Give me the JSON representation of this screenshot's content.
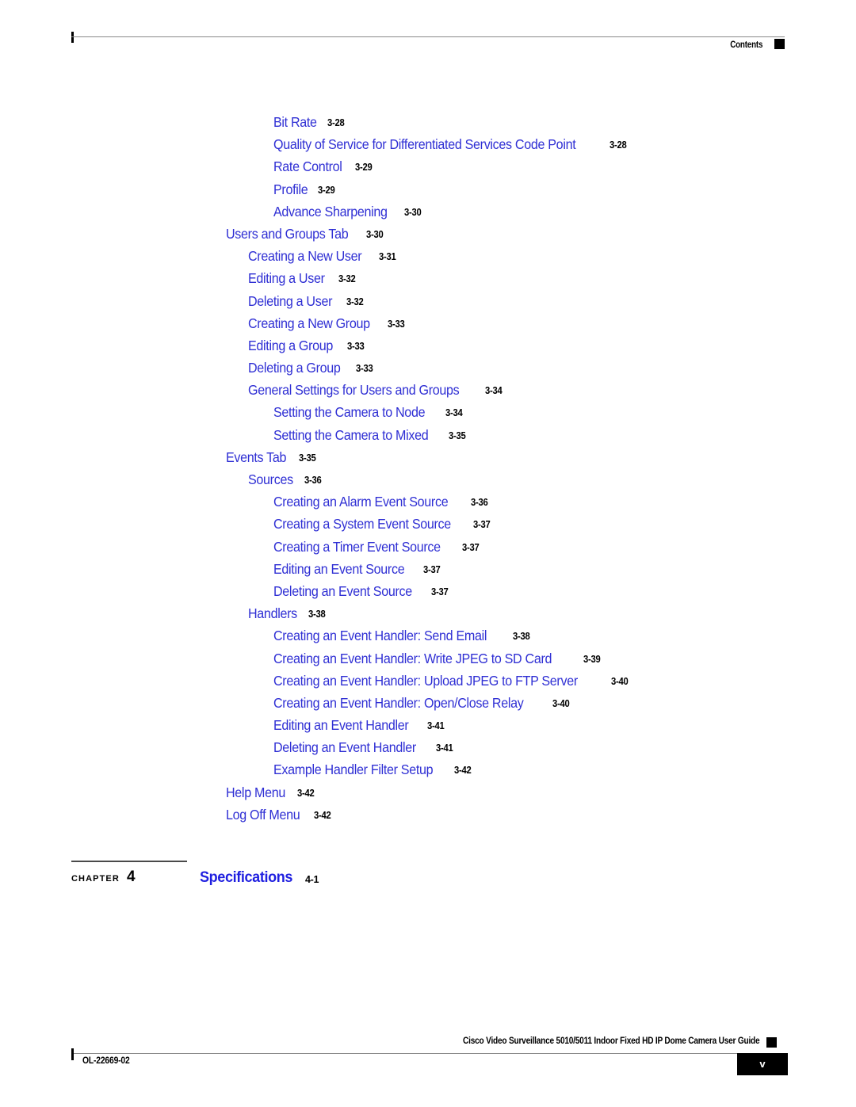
{
  "header": {
    "label": "Contents"
  },
  "toc": {
    "entries": [
      {
        "title": "Bit Rate",
        "page": "3-28",
        "level": 3
      },
      {
        "title": "Quality of Service for Differentiated Services Code Point",
        "page": "3-28",
        "level": 3
      },
      {
        "title": "Rate Control",
        "page": "3-29",
        "level": 3
      },
      {
        "title": "Profile",
        "page": "3-29",
        "level": 3
      },
      {
        "title": "Advance Sharpening",
        "page": "3-30",
        "level": 3
      },
      {
        "title": "Users and Groups Tab",
        "page": "3-30",
        "level": 1
      },
      {
        "title": "Creating a New User",
        "page": "3-31",
        "level": 2
      },
      {
        "title": "Editing a User",
        "page": "3-32",
        "level": 2
      },
      {
        "title": "Deleting a User",
        "page": "3-32",
        "level": 2
      },
      {
        "title": "Creating a New Group",
        "page": "3-33",
        "level": 2
      },
      {
        "title": "Editing a Group",
        "page": "3-33",
        "level": 2
      },
      {
        "title": "Deleting a Group",
        "page": "3-33",
        "level": 2
      },
      {
        "title": "General Settings for Users and Groups",
        "page": "3-34",
        "level": 2
      },
      {
        "title": "Setting the Camera to Node",
        "page": "3-34",
        "level": 3
      },
      {
        "title": "Setting the Camera to Mixed",
        "page": "3-35",
        "level": 3
      },
      {
        "title": "Events Tab",
        "page": "3-35",
        "level": 1
      },
      {
        "title": "Sources",
        "page": "3-36",
        "level": 2
      },
      {
        "title": "Creating an Alarm Event Source",
        "page": "3-36",
        "level": 3
      },
      {
        "title": "Creating a System Event Source",
        "page": "3-37",
        "level": 3
      },
      {
        "title": "Creating a Timer Event Source",
        "page": "3-37",
        "level": 3
      },
      {
        "title": "Editing an Event Source",
        "page": "3-37",
        "level": 3
      },
      {
        "title": "Deleting an Event Source",
        "page": "3-37",
        "level": 3
      },
      {
        "title": "Handlers",
        "page": "3-38",
        "level": 2
      },
      {
        "title": "Creating an Event Handler: Send Email",
        "page": "3-38",
        "level": 3
      },
      {
        "title": "Creating an Event Handler: Write JPEG to SD Card",
        "page": "3-39",
        "level": 3
      },
      {
        "title": "Creating an Event Handler: Upload JPEG to FTP Server",
        "page": "3-40",
        "level": 3
      },
      {
        "title": "Creating an Event Handler: Open/Close Relay",
        "page": "3-40",
        "level": 3
      },
      {
        "title": "Editing an Event Handler",
        "page": "3-41",
        "level": 3
      },
      {
        "title": "Deleting an Event Handler",
        "page": "3-41",
        "level": 3
      },
      {
        "title": "Example Handler Filter Setup",
        "page": "3-42",
        "level": 3
      },
      {
        "title": "Help Menu",
        "page": "3-42",
        "level": 1
      },
      {
        "title": "Log Off Menu",
        "page": "3-42",
        "level": 1
      }
    ]
  },
  "chapter": {
    "word": "CHAPTER",
    "number": "4",
    "title": "Specifications",
    "page": "4-1"
  },
  "footer": {
    "guide_title": "Cisco Video Surveillance 5010/5011 Indoor Fixed HD IP Dome Camera User Guide",
    "doc_id": "OL-22669-02",
    "page_number": "v"
  }
}
